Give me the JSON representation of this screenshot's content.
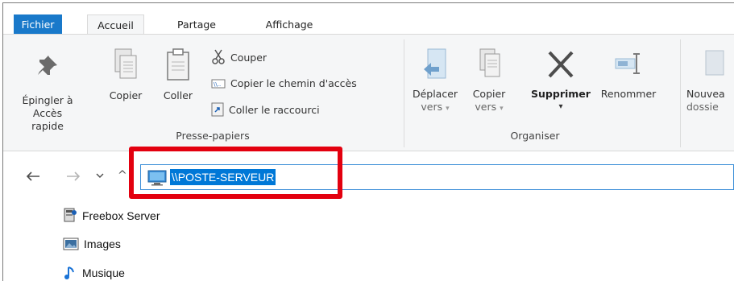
{
  "tabs": {
    "file": "Fichier",
    "home": "Accueil",
    "share": "Partage",
    "view": "Affichage"
  },
  "clipboard": {
    "pin_line1": "Épingler à",
    "pin_line2": "Accès rapide",
    "copy": "Copier",
    "paste": "Coller",
    "cut": "Couper",
    "copy_path": "Copier le chemin d'accès",
    "paste_shortcut": "Coller le raccourci",
    "group_label": "Presse-papiers"
  },
  "organize": {
    "move_line1": "Déplacer",
    "move_line2": "vers",
    "copy_line1": "Copier",
    "copy_line2": "vers",
    "delete": "Supprimer",
    "rename": "Renommer",
    "group_label": "Organiser"
  },
  "new": {
    "new_line1": "Nouvea",
    "new_line2": "dossie"
  },
  "address": {
    "value": "\\\\POSTE-SERVEUR"
  },
  "nav": {
    "up_arrow": "^"
  },
  "tree": {
    "items": [
      {
        "label": "Freebox Server",
        "icon": "freebox-server-icon"
      },
      {
        "label": "Images",
        "icon": "images-icon"
      },
      {
        "label": "Musique",
        "icon": "music-icon"
      }
    ]
  },
  "colors": {
    "file_tab": "#1979ca",
    "selection": "#0078d7",
    "highlight_frame": "#e3000f"
  }
}
